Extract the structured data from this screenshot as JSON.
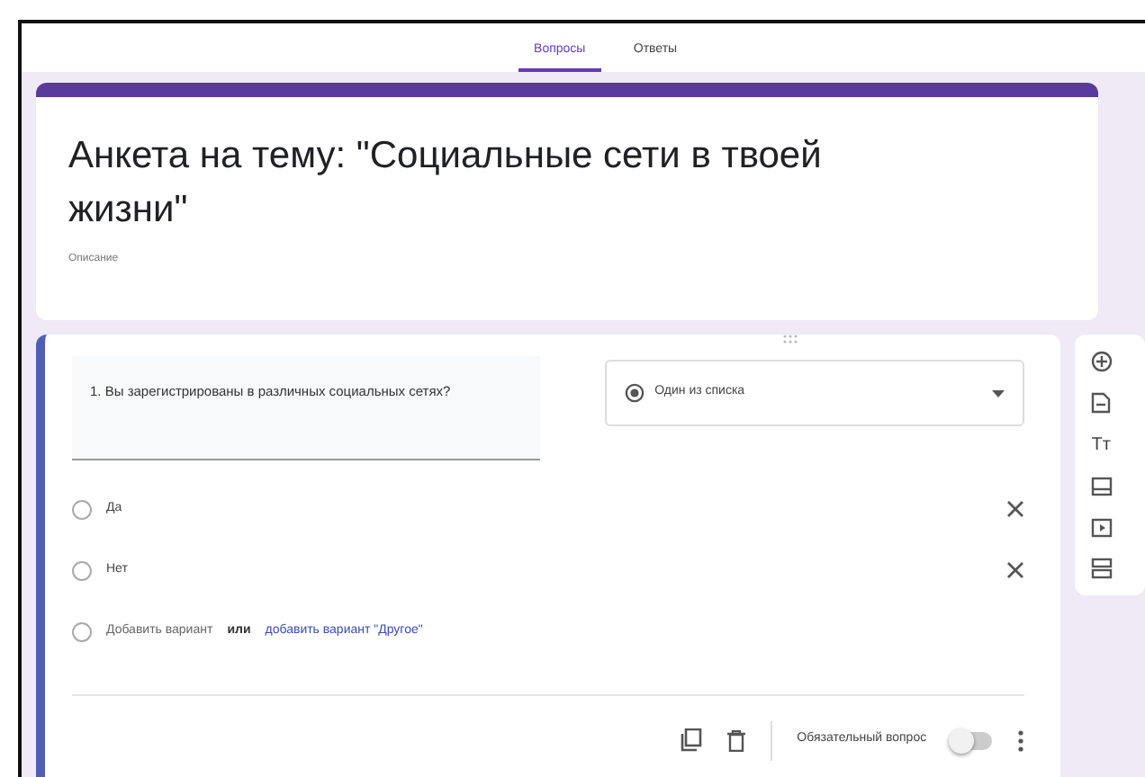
{
  "tabs": [
    {
      "label": "Вопросы",
      "selected": true
    },
    {
      "label": "Ответы",
      "selected": false
    }
  ],
  "form": {
    "title": "Анкета на тему: \"Социальные сети в твоей жизни\"",
    "description_placeholder": "Описание"
  },
  "question": {
    "title": "1. Вы зарегистрированы в различных социальных сетях?",
    "type": "Один из списка",
    "options": [
      {
        "label": "Да",
        "checked": false
      },
      {
        "label": "Нет",
        "checked": false
      }
    ],
    "add_option": "Добавить вариант",
    "add_option_checked": false,
    "or": "или",
    "add_other": "добавить вариант \"Другое\"",
    "required_label": "Обязательный вопрос",
    "required": false
  },
  "sidebar": [
    {
      "kind": "add"
    },
    {
      "kind": "import"
    },
    {
      "kind": "text",
      "glyph": "Tт"
    },
    {
      "kind": "image"
    },
    {
      "kind": "video"
    },
    {
      "kind": "section"
    }
  ]
}
